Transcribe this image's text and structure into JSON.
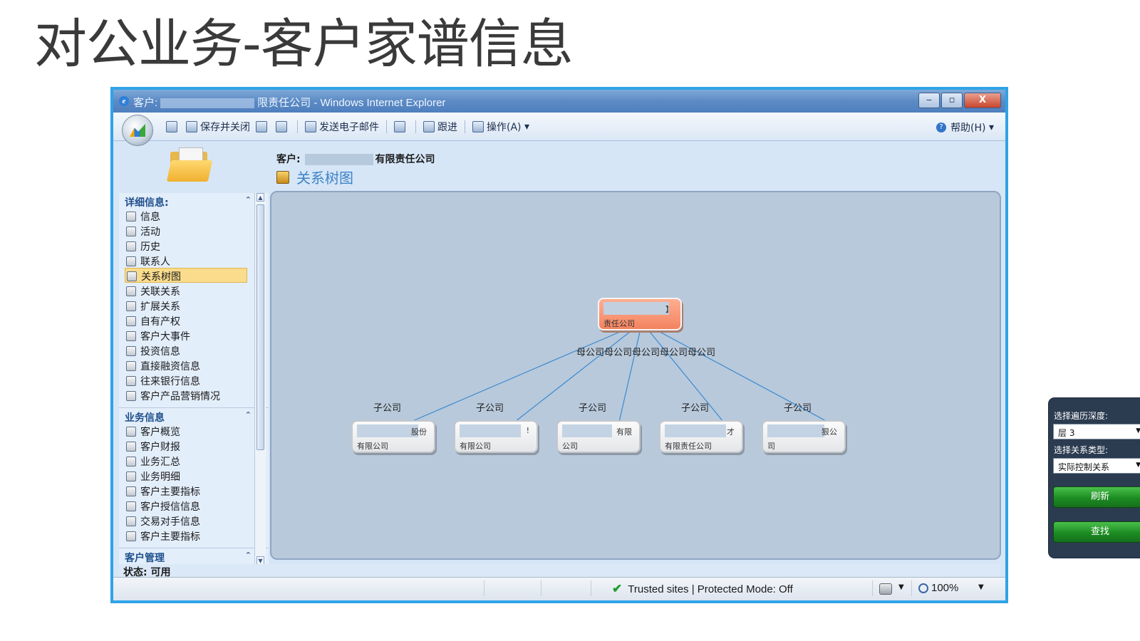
{
  "slide": {
    "title": "对公业务-客户家谱信息"
  },
  "window": {
    "title_prefix": "客户:",
    "title_suffix": "限责任公司 - Windows Internet Explorer",
    "min": "‒",
    "max": "▫",
    "close": "X"
  },
  "toolbar": {
    "save_close": "保存并关闭",
    "send_email": "发送电子邮件",
    "follow_up": "跟进",
    "actions": "操作(A)",
    "help": "帮助(H)"
  },
  "header": {
    "customer_label": "客户:",
    "customer_name_suffix": "有限责任公司",
    "view_title": "关系树图"
  },
  "nav": {
    "detail_section": "详细信息:",
    "detail_items": [
      "信息",
      "活动",
      "历史",
      "联系人",
      "关系树图",
      "关联关系",
      "扩展关系",
      "自有产权",
      "客户大事件",
      "投资信息",
      "直接融资信息",
      "往来银行信息",
      "客户产品营销情况"
    ],
    "business_section": "业务信息",
    "business_items": [
      "客户概览",
      "客户财报",
      "业务汇总",
      "业务明细",
      "客户主要指标",
      "客户授信信息",
      "交易对手信息",
      "客户主要指标"
    ],
    "mgmt_section": "客户管理"
  },
  "status": {
    "text": "状态: 可用"
  },
  "tree": {
    "root": {
      "t1": "】",
      "t2": "责任公司"
    },
    "parent_label": "母公司母公司母公司母公司母公司",
    "child_edge_label": "子公司",
    "children": [
      {
        "t1": "股份",
        "t2": "有限公司"
      },
      {
        "t1": "!",
        "t2": "有限公司"
      },
      {
        "t1": "有限",
        "t2": "公司"
      },
      {
        "t1": "才",
        "t2": "有限责任公司"
      },
      {
        "t1": "狠公",
        "t2": "司"
      }
    ]
  },
  "controls": {
    "depth_label": "选择遍历深度:",
    "depth_value": "层 3",
    "type_label": "选择关系类型:",
    "type_value": "实际控制关系",
    "refresh": "刷新",
    "find": "查找"
  },
  "ie_status": {
    "zone": "Trusted sites | Protected Mode: Off",
    "zoom": "100%"
  }
}
